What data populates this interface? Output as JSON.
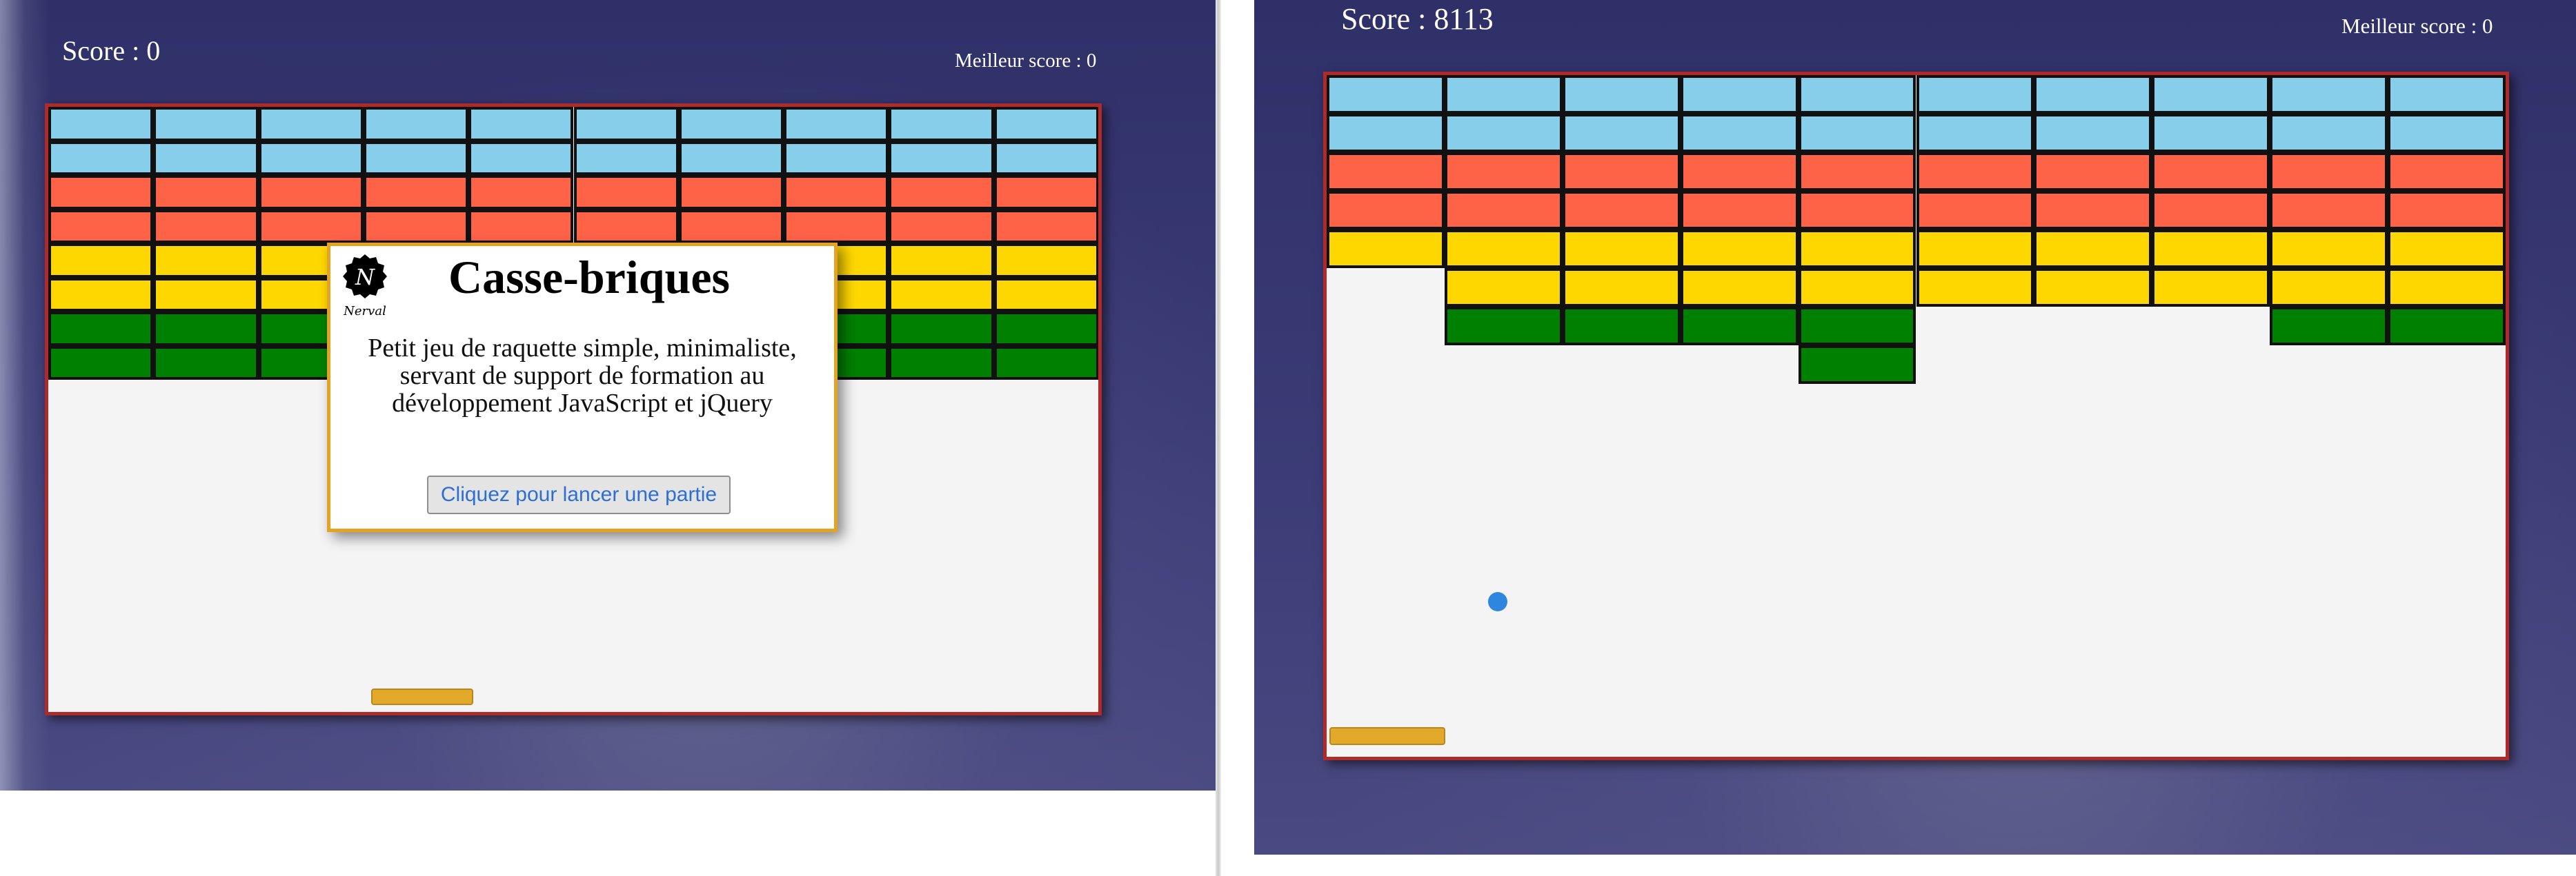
{
  "colors": {
    "blue": "#87ceeb",
    "red": "#ff6347",
    "yellow": "#ffd700",
    "green": "#008000",
    "ball": "#2e86de",
    "paddle": "#e3a92a",
    "board_border": "#b02a2a",
    "modal_border": "#e6a321"
  },
  "left": {
    "score_text": "Score : 0",
    "best_text": "Meilleur score : 0",
    "brick_rows": [
      "blue",
      "blue",
      "red",
      "red",
      "yellow",
      "yellow",
      "green",
      "green"
    ],
    "modal": {
      "logo_icon": "nerval-logo-icon",
      "logo_text": "Nerval",
      "logo_letter": "N",
      "title": "Casse-briques",
      "desc_line1": "Petit jeu de raquette simple, minimaliste,",
      "desc_line2": "servant de support de formation au",
      "desc_line3": "développement JavaScript et jQuery",
      "button": "Cliquez pour lancer une partie"
    }
  },
  "right": {
    "score_text": "Score : 8113",
    "best_text": "Meilleur score : 0",
    "brick_rows": [
      {
        "color": "blue",
        "present": [
          1,
          1,
          1,
          1,
          1,
          1,
          1,
          1,
          1,
          1
        ]
      },
      {
        "color": "blue",
        "present": [
          1,
          1,
          1,
          1,
          1,
          1,
          1,
          1,
          1,
          1
        ]
      },
      {
        "color": "red",
        "present": [
          1,
          1,
          1,
          1,
          1,
          1,
          1,
          1,
          1,
          1
        ]
      },
      {
        "color": "red",
        "present": [
          1,
          1,
          1,
          1,
          1,
          1,
          1,
          1,
          1,
          1
        ]
      },
      {
        "color": "yellow",
        "present": [
          1,
          1,
          1,
          1,
          1,
          1,
          1,
          1,
          1,
          1
        ]
      },
      {
        "color": "yellow",
        "present": [
          0,
          1,
          1,
          1,
          1,
          1,
          1,
          1,
          1,
          1
        ]
      },
      {
        "color": "green",
        "present": [
          0,
          1,
          1,
          1,
          1,
          0,
          0,
          0,
          1,
          1
        ]
      },
      {
        "color": "green",
        "present": [
          0,
          0,
          0,
          0,
          1,
          0,
          0,
          0,
          0,
          0
        ]
      }
    ]
  }
}
